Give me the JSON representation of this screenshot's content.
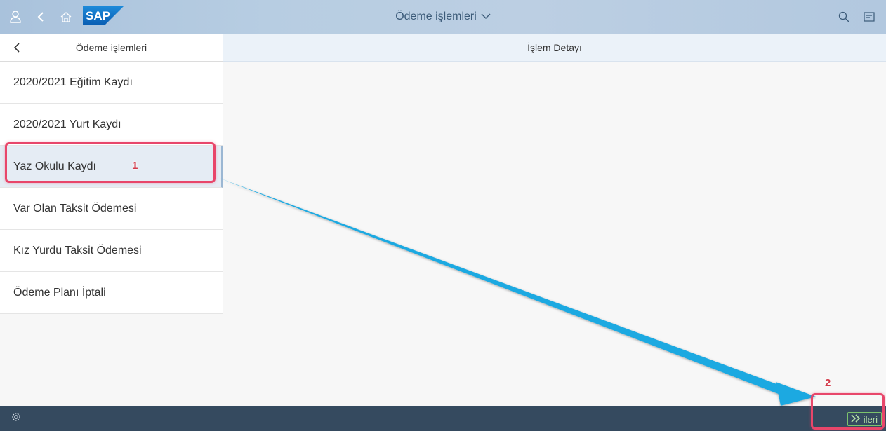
{
  "shell": {
    "title": "Ödeme işlemleri",
    "logo_text": "SAP",
    "icons": [
      "user-icon",
      "back-icon",
      "home-icon",
      "search-icon",
      "notifications-icon"
    ]
  },
  "master": {
    "title": "Ödeme işlemleri",
    "items": [
      {
        "label": "2020/2021 Eğitim Kaydı"
      },
      {
        "label": "2020/2021 Yurt Kaydı"
      },
      {
        "label": "Yaz Okulu Kaydı",
        "selected": true
      },
      {
        "label": "Var Olan Taksit Ödemesi"
      },
      {
        "label": "Kız Yurdu Taksit Ödemesi"
      },
      {
        "label": "Ödeme Planı İptali"
      }
    ]
  },
  "detail": {
    "title": "İşlem Detayı"
  },
  "footer": {
    "next_label": "ileri"
  },
  "annotations": {
    "step1": "1",
    "step2": "2"
  },
  "colors": {
    "shell_bg": "#b7cde2",
    "footer_bg": "#354a5f",
    "annotation": "#e8466a",
    "arrow": "#1fa9e1",
    "next_button": "#7cc26c"
  }
}
